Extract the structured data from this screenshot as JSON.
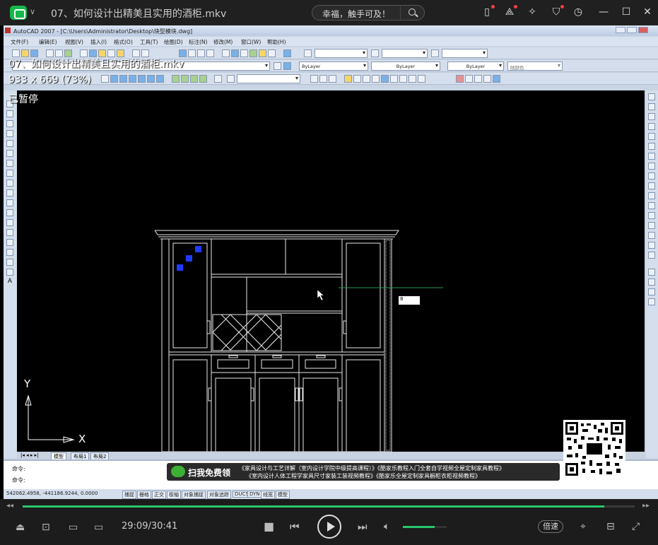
{
  "player": {
    "title": "07、如何设计出精美且实用的酒柜.mkv",
    "search_text": "幸福，触手可及！",
    "overlay_name": "07、如何设计出精美且实用的酒柜.mkv",
    "overlay_size": "933 x 669 (73%)",
    "overlay_status": "已暂停",
    "time_display": "29:09/30:41",
    "progress": 0.95,
    "volume": 0.72,
    "speed_label": "倍速",
    "accent_color": "#28c76f"
  },
  "cad": {
    "title": "AutoCAD 2007 - [C:\\Users\\Administrator\\Desktop\\块型模块.dwg]",
    "menu": [
      "文件(F)",
      "编辑(E)",
      "视图(V)",
      "插入(I)",
      "格式(O)",
      "工具(T)",
      "绘图(D)",
      "标注(N)",
      "修改(M)",
      "窗口(W)",
      "帮助(H)"
    ],
    "layer_props": [
      "ByLayer",
      "ByLayer",
      "ByLayer",
      "随颜色"
    ],
    "input_value": "8",
    "axis_y": "Y",
    "axis_x": "X",
    "tabs": [
      "模型",
      "布局1",
      "布局2"
    ],
    "cmd_prompt_1": "命令:",
    "cmd_prompt_2": "命令:",
    "coords": "542062.4958, -441186.9244, 0.0000",
    "status_buttons": [
      "捕捉",
      "栅格",
      "正交",
      "极轴",
      "对象捕捉",
      "对象追踪",
      "DUCS",
      "DYN",
      "线宽",
      "模型"
    ]
  },
  "banner": {
    "lead": "扫我免费领",
    "line1": "《家具设计与工艺详解（室内设计学院中级提高课程）》《酷家乐教程入门全套自学视频全屋定制家具教程》",
    "line2": "《室内设计人体工程学家具尺寸家装工装视频教程》《酷家乐全屋定制家具橱柜衣柜视频教程》"
  }
}
